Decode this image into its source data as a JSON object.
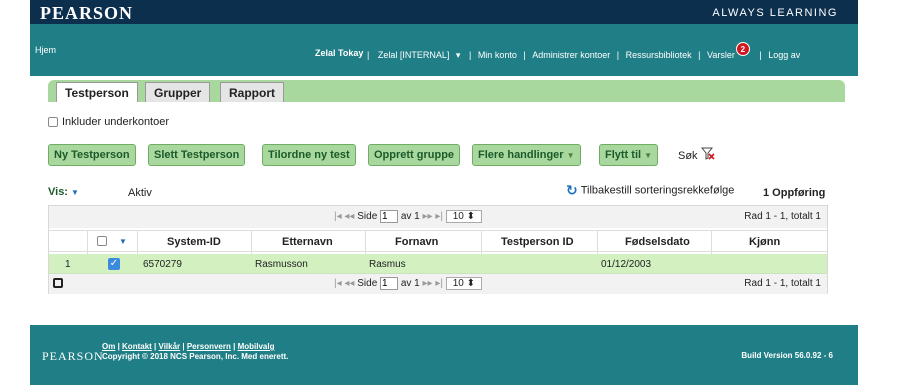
{
  "brand": "PEARSON",
  "tagline": "ALWAYS LEARNING",
  "nav": {
    "home": "Hjem",
    "user": "Zelal Tokay",
    "account_menu": "Zelal [INTERNAL]",
    "my_account": "Min konto",
    "manage_accounts": "Administrer kontoer",
    "resources": "Ressursbibliotek",
    "notifications": "Varsler",
    "notifications_count": "2",
    "logout": "Logg av"
  },
  "tabs": [
    "Testperson",
    "Grupper",
    "Rapport"
  ],
  "include_subaccounts": "Inkluder underkontoer",
  "actions": {
    "new": "Ny Testperson",
    "delete": "Slett Testperson",
    "assign": "Tilordne ny test",
    "create_group": "Opprett gruppe",
    "more": "Flere handlinger",
    "move": "Flytt til",
    "search": "Søk"
  },
  "view": {
    "label": "Vis:",
    "value": "Aktiv",
    "reset_sort": "Tilbakestill sorteringsrekkefølge",
    "count": "1 Oppføring"
  },
  "pager": {
    "page_label": "Side",
    "page": "1",
    "of_label": "av 1",
    "page_size": "10",
    "range": "Rad 1 - 1, totalt 1"
  },
  "table": {
    "headers": [
      "System-ID",
      "Etternavn",
      "Fornavn",
      "Testperson ID",
      "Fødselsdato",
      "Kjønn"
    ],
    "rows": [
      {
        "num": "1",
        "system_id": "6570279",
        "last": "Rasmusson",
        "first": "Rasmus",
        "tp_id": "",
        "dob": "01/12/2003",
        "gender": ""
      }
    ]
  },
  "footer": {
    "brand": "PEARSON",
    "links": [
      "Om",
      "Kontakt",
      "Vilkår",
      "Personvern",
      "Mobilvalg"
    ],
    "copyright": "Copyright © 2018 NCS Pearson, Inc. Med enerett.",
    "build": "Build Version 56.0.92 - 6"
  }
}
